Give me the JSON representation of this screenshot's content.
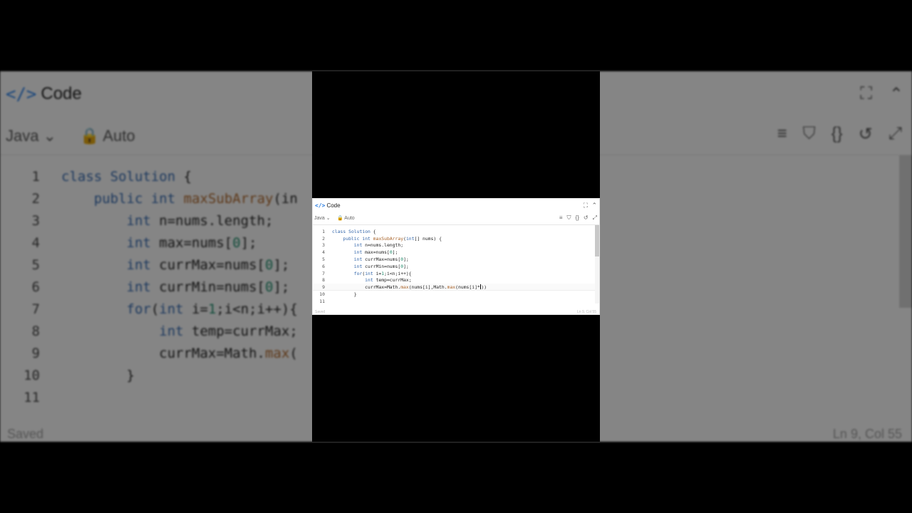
{
  "editor": {
    "title": "Code",
    "title_icon": "code-brackets-icon",
    "language": "Java",
    "mode": "Auto",
    "status_left": "Saved",
    "status_right": "Ln 9, Col 55",
    "accent_color": "#2a7de1"
  },
  "code_lines": [
    {
      "n": "1",
      "text": "class Solution {"
    },
    {
      "n": "2",
      "text": "    public int maxSubArray(int[] nums) {"
    },
    {
      "n": "3",
      "text": "        int n=nums.length;"
    },
    {
      "n": "4",
      "text": "        int max=nums[0];"
    },
    {
      "n": "5",
      "text": "        int currMax=nums[0];"
    },
    {
      "n": "6",
      "text": "        int currMin=nums[0];"
    },
    {
      "n": "7",
      "text": "        for(int i=1;i<n;i++){"
    },
    {
      "n": "8",
      "text": "            int temp=currMax;"
    },
    {
      "n": "9",
      "text": "            currMax=Math.max(nums[i],Math.max(nums[i]*))"
    },
    {
      "n": "10",
      "text": "        }"
    },
    {
      "n": "11",
      "text": ""
    }
  ],
  "background": {
    "code_lines": [
      {
        "n": "1",
        "text": "class Solution {"
      },
      {
        "n": "2",
        "text": "    public int maxSubArray(in"
      },
      {
        "n": "3",
        "text": "        int n=nums.length;"
      },
      {
        "n": "4",
        "text": "        int max=nums[0];"
      },
      {
        "n": "5",
        "text": "        int currMax=nums[0];"
      },
      {
        "n": "6",
        "text": "        int currMin=nums[0];"
      },
      {
        "n": "7",
        "text": "        for(int i=1;i<n;i++){"
      },
      {
        "n": "8",
        "text": "            int temp=currMax;"
      },
      {
        "n": "9",
        "text": "            currMax=Math.max("
      },
      {
        "n": "10",
        "text": "        }"
      },
      {
        "n": "11",
        "text": ""
      }
    ]
  }
}
